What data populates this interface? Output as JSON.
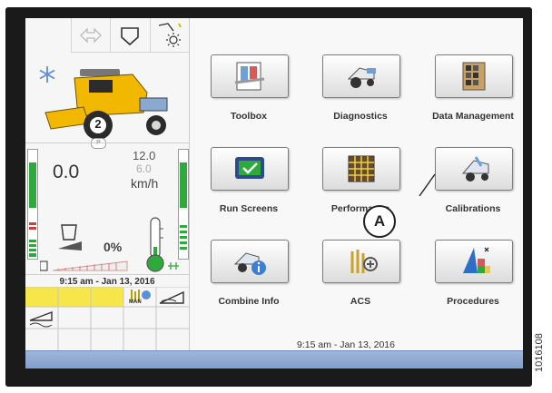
{
  "status": {
    "speed_value": "0.0",
    "speed_max": "12.0",
    "speed_min": "6.0",
    "speed_unit": "km/h",
    "header_percent": "0%",
    "gear": "2",
    "park": "P",
    "time": "9:15 am - Jan 13, 2016",
    "man_label": "MAN"
  },
  "menu": {
    "items": [
      {
        "label": "Toolbox",
        "icon": "toolbox-icon"
      },
      {
        "label": "Diagnostics",
        "icon": "diagnostics-icon"
      },
      {
        "label": "Data Management",
        "icon": "data-management-icon"
      },
      {
        "label": "Run Screens",
        "icon": "run-screens-icon"
      },
      {
        "label": "Performance",
        "icon": "performance-icon"
      },
      {
        "label": "Calibrations",
        "icon": "calibrations-icon"
      },
      {
        "label": "Combine Info",
        "icon": "combine-info-icon"
      },
      {
        "label": "ACS",
        "icon": "acs-icon"
      },
      {
        "label": "Procedures",
        "icon": "procedures-icon"
      }
    ],
    "time": "9:15 am - Jan 13, 2016"
  },
  "annotation": {
    "marker": "A"
  },
  "figure_id": "1016108",
  "colors": {
    "accent_green": "#2eaa3c",
    "warning_red": "#d43b3b",
    "combine_yellow": "#f2b800",
    "status_bar": "#8aa6d2",
    "yellow_cell": "#f7e64a"
  }
}
